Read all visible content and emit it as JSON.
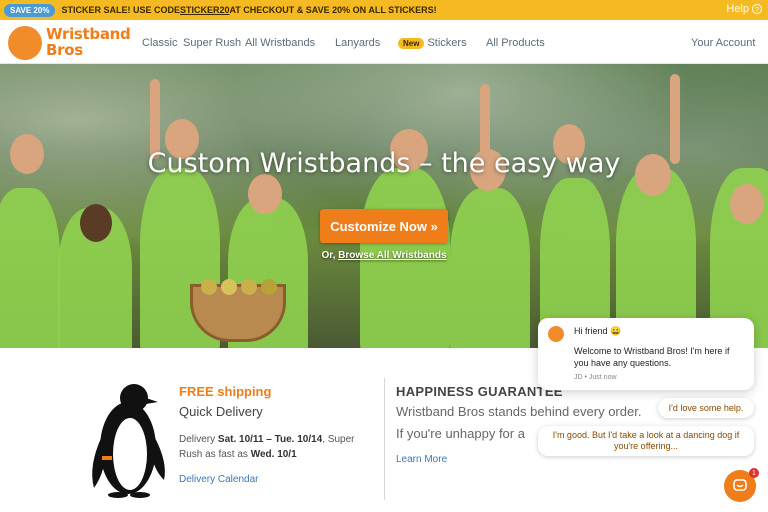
{
  "promo": {
    "pill": "SAVE 20%",
    "text_before": "STICKER SALE! USE CODE ",
    "code": "STICKER20",
    "text_after": " AT CHECKOUT & SAVE 20% ON ALL STICKERS!",
    "help": "Help"
  },
  "nav": {
    "logo_line1": "Wristband",
    "logo_line2": "Bros",
    "links": [
      "Classic",
      "Super Rush",
      "All Wristbands",
      "Lanyards",
      "Stickers",
      "All Products"
    ],
    "new_badge": "New",
    "account": "Your Account"
  },
  "hero": {
    "title": "Custom Wristbands – the easy way",
    "cta": "Customize Now »",
    "browse_prefix": "Or, ",
    "browse_link": "Browse All Wristbands"
  },
  "shipping": {
    "title": "FREE shipping",
    "subtitle": "Quick Delivery",
    "text_pre": "Delivery ",
    "dates": "Sat. 10/11 – Tue. 10/14",
    "text_mid": ", Super Rush as fast as ",
    "rush_date": "Wed. 10/1",
    "calendar_link": "Delivery Calendar"
  },
  "guarantee": {
    "title": "HAPPINESS GUARANTEE",
    "line1": "Wristband Bros stands behind every order.",
    "line2": "If you're unhappy for a",
    "learn_more": "Learn More"
  },
  "chat": {
    "greeting": "Hi friend 😀",
    "message": "Welcome to Wristband Bros! I'm here if you have any questions.",
    "meta": "JD • Just now",
    "reply1": "I'd love some help.",
    "reply2": "I'm good. But I'd take a look at a dancing dog if you're offering...",
    "unread": "1"
  },
  "colors": {
    "promo_bg": "#f5b921",
    "accent": "#ef7d1a",
    "link": "#3a78b5"
  }
}
